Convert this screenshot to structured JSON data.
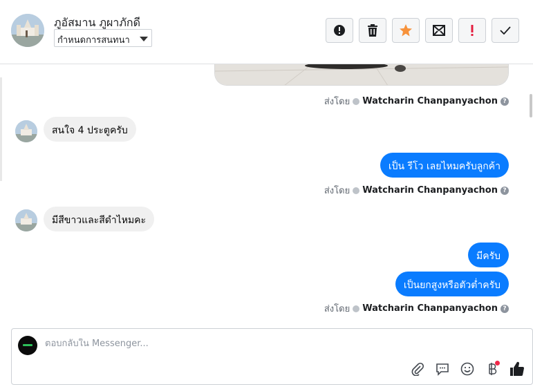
{
  "header": {
    "contact_name": "ภูอัสมาน ภูผาภักดี",
    "label_select": "กำหนดการสนทนา",
    "actions": [
      {
        "name": "spam-button",
        "icon": "alert-circle-icon"
      },
      {
        "name": "delete-button",
        "icon": "trash-icon"
      },
      {
        "name": "star-button",
        "icon": "star-icon",
        "color": "#f7923b"
      },
      {
        "name": "mark-unread-button",
        "icon": "envelope-icon"
      },
      {
        "name": "follow-up-button",
        "icon": "exclamation-icon",
        "color": "#e41e3f"
      },
      {
        "name": "mark-done-button",
        "icon": "checkmark-icon"
      }
    ]
  },
  "conversation": {
    "sent_by_label": "ส่งโดย",
    "agent_name": "Watcharin Chanpanyachon",
    "messages": [
      {
        "id": "m1",
        "direction": "in",
        "text": "สนใจ 4 ประตูครับ"
      },
      {
        "id": "m2",
        "direction": "out",
        "text": "เป็น รีโว เลยไหมครับลูกค้า"
      },
      {
        "id": "m3",
        "direction": "in",
        "text": "มีสีขาวและสีดำไหมคะ"
      },
      {
        "id": "m4",
        "direction": "out",
        "text": "มีครับ"
      },
      {
        "id": "m5",
        "direction": "out",
        "text": "เป็นยกสูงหรือตัวต่ำครับ"
      }
    ]
  },
  "composer": {
    "placeholder": "ตอบกลับใน Messenger...",
    "value": "",
    "icons": [
      "attachment-icon",
      "saved-reply-icon",
      "emoji-icon",
      "payment-icon",
      "like-icon"
    ]
  },
  "colors": {
    "outgoing_bubble": "#0a7cff",
    "incoming_bubble": "#f0f0f0"
  }
}
